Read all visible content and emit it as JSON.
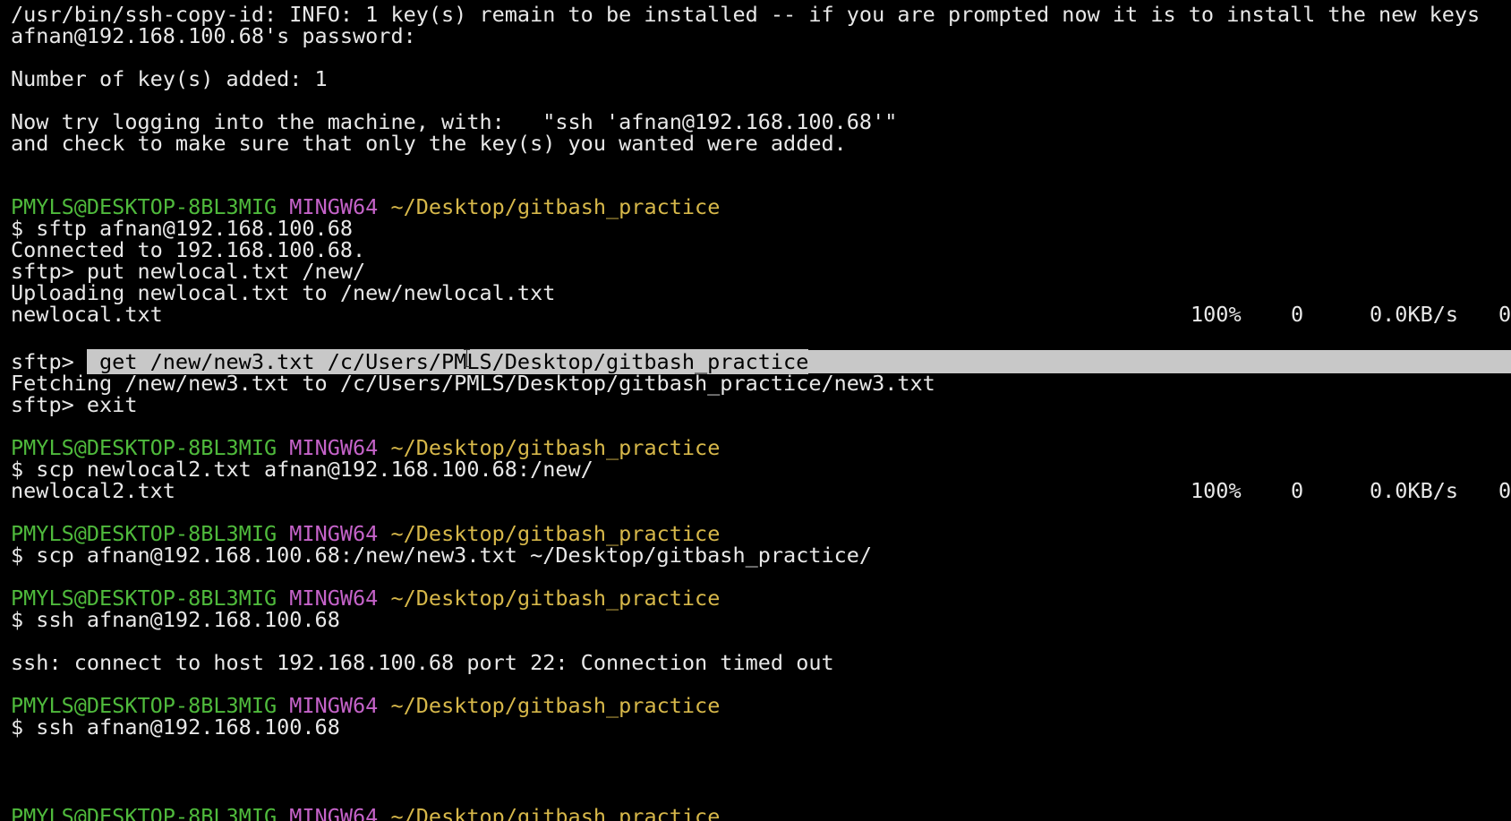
{
  "terminal": {
    "lines": {
      "l0": "/usr/bin/ssh-copy-id: INFO: 1 key(s) remain to be installed -- if you are prompted now it is to install the new keys",
      "l1": "afnan@192.168.100.68's password:",
      "l2": "Number of key(s) added: 1",
      "l3": "Now try logging into the machine, with:   \"ssh 'afnan@192.168.100.68'\"",
      "l4": "and check to make sure that only the key(s) you wanted were added."
    },
    "prompt": {
      "user_host": "PMYLS@DESKTOP-8BL3MIG",
      "shell": "MINGW64",
      "path": "~/Desktop/gitbash_practice"
    },
    "session1": {
      "cmd": "$ sftp afnan@192.168.100.68",
      "connected": "Connected to 192.168.100.68.",
      "put_cmd": "sftp> put newlocal.txt /new/",
      "uploading": "Uploading newlocal.txt to /new/newlocal.txt",
      "file": "newlocal.txt",
      "pct": "100%",
      "size": "0",
      "rate": "0.0KB/s",
      "eta": "0",
      "get_prefix": "sftp> ",
      "get_cmd": " get /new/new3.txt /c/Users/PMLS/Desktop/gitbash_practice",
      "fetching": "Fetching /new/new3.txt to /c/Users/PMLS/Desktop/gitbash_practice/new3.txt",
      "exit_cmd": "sftp> exit"
    },
    "session2": {
      "cmd": "$ scp newlocal2.txt afnan@192.168.100.68:/new/",
      "file": "newlocal2.txt",
      "pct": "100%",
      "size": "0",
      "rate": "0.0KB/s",
      "eta": "0"
    },
    "session3": {
      "cmd": "$ scp afnan@192.168.100.68:/new/new3.txt ~/Desktop/gitbash_practice/"
    },
    "session4": {
      "cmd": "$ ssh afnan@192.168.100.68",
      "error": "ssh: connect to host 192.168.100.68 port 22: Connection timed out"
    },
    "session5": {
      "cmd": "$ ssh afnan@192.168.100.68"
    }
  },
  "colors": {
    "background": "#000000",
    "text": "#e8e8e8",
    "prompt_user": "#4fba3c",
    "prompt_shell": "#c563c9",
    "prompt_path": "#d7b84a",
    "selection": "#c8c8c8"
  }
}
